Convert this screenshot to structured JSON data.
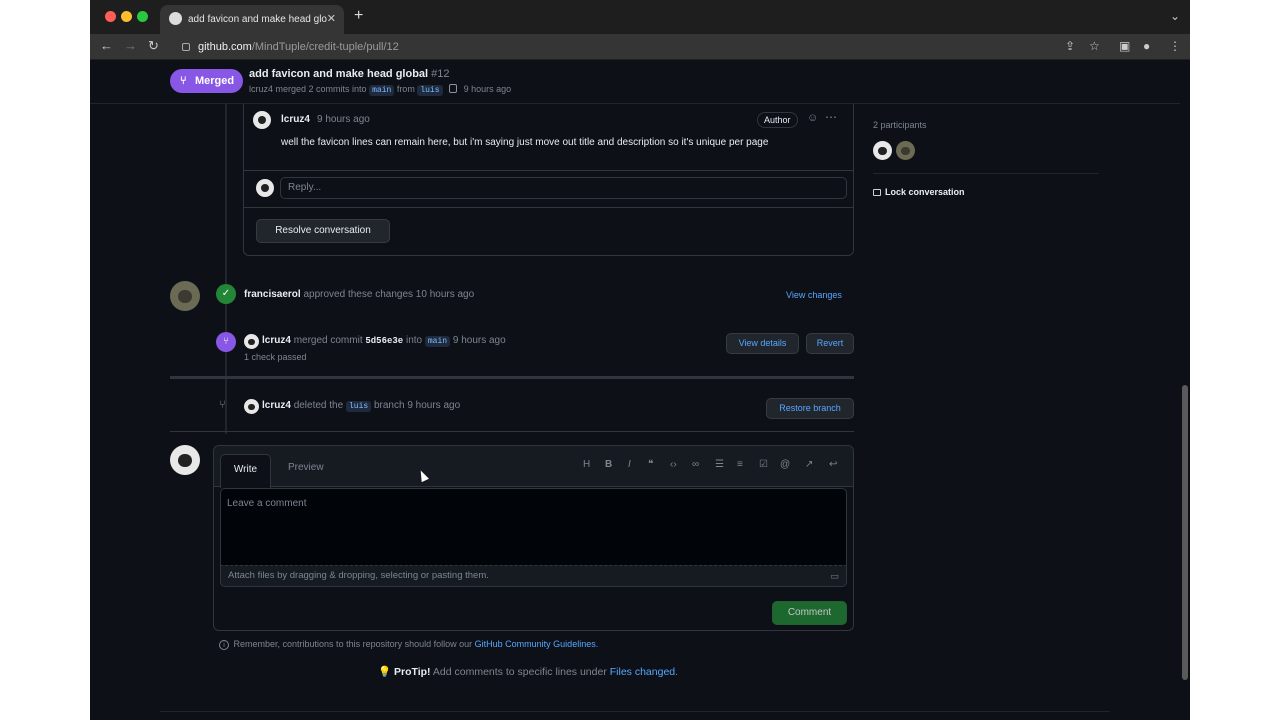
{
  "browser": {
    "tab_title": "add favicon and make head glo",
    "tab_close": "✕",
    "new_tab": "+",
    "url_domain": "github.com",
    "url_path": "/MindTuple/credit-tuple/pull/12"
  },
  "pr": {
    "status": "Merged",
    "title": "add favicon and make head global",
    "number": "#12",
    "author": "lcruz4",
    "merged_text": "merged 2 commits into",
    "base_branch": "main",
    "from_text": "from",
    "head_branch": "luis",
    "time": "9 hours ago"
  },
  "review_comment": {
    "author": "lcruz4",
    "time": "9 hours ago",
    "badge": "Author",
    "body": "well the favicon lines can remain here, but i'm saying just move out title and description so it's unique per page",
    "reply_placeholder": "Reply...",
    "resolve_label": "Resolve conversation"
  },
  "sidebar": {
    "participants_label": "2 participants",
    "lock_label": "Lock conversation"
  },
  "events": {
    "approved": {
      "user": "francisaerol",
      "text": "approved these changes",
      "time": "10 hours ago",
      "action": "View changes"
    },
    "merged": {
      "user": "lcruz4",
      "text": "merged commit",
      "sha": "5d56e3e",
      "into": "into",
      "branch": "main",
      "time": "9 hours ago",
      "checks": "1 check passed",
      "details_label": "View details",
      "revert_label": "Revert"
    },
    "deleted": {
      "user": "lcruz4",
      "text": "deleted the",
      "branch": "luis",
      "suffix": "branch",
      "time": "9 hours ago",
      "restore_label": "Restore branch"
    }
  },
  "composer": {
    "tab_write": "Write",
    "tab_preview": "Preview",
    "placeholder": "Leave a comment",
    "attach_text": "Attach files by dragging & dropping, selecting or pasting them.",
    "submit_label": "Comment"
  },
  "footer": {
    "guidelines_prefix": "Remember, contributions to this repository should follow our",
    "guidelines_link": "GitHub Community Guidelines",
    "protip_label": "ProTip!",
    "protip_text": "Add comments to specific lines under",
    "protip_link": "Files changed"
  },
  "colors": {
    "merged": "#8957e5",
    "approved": "#238636",
    "link": "#58a6ff",
    "comment_button": "#238636"
  }
}
